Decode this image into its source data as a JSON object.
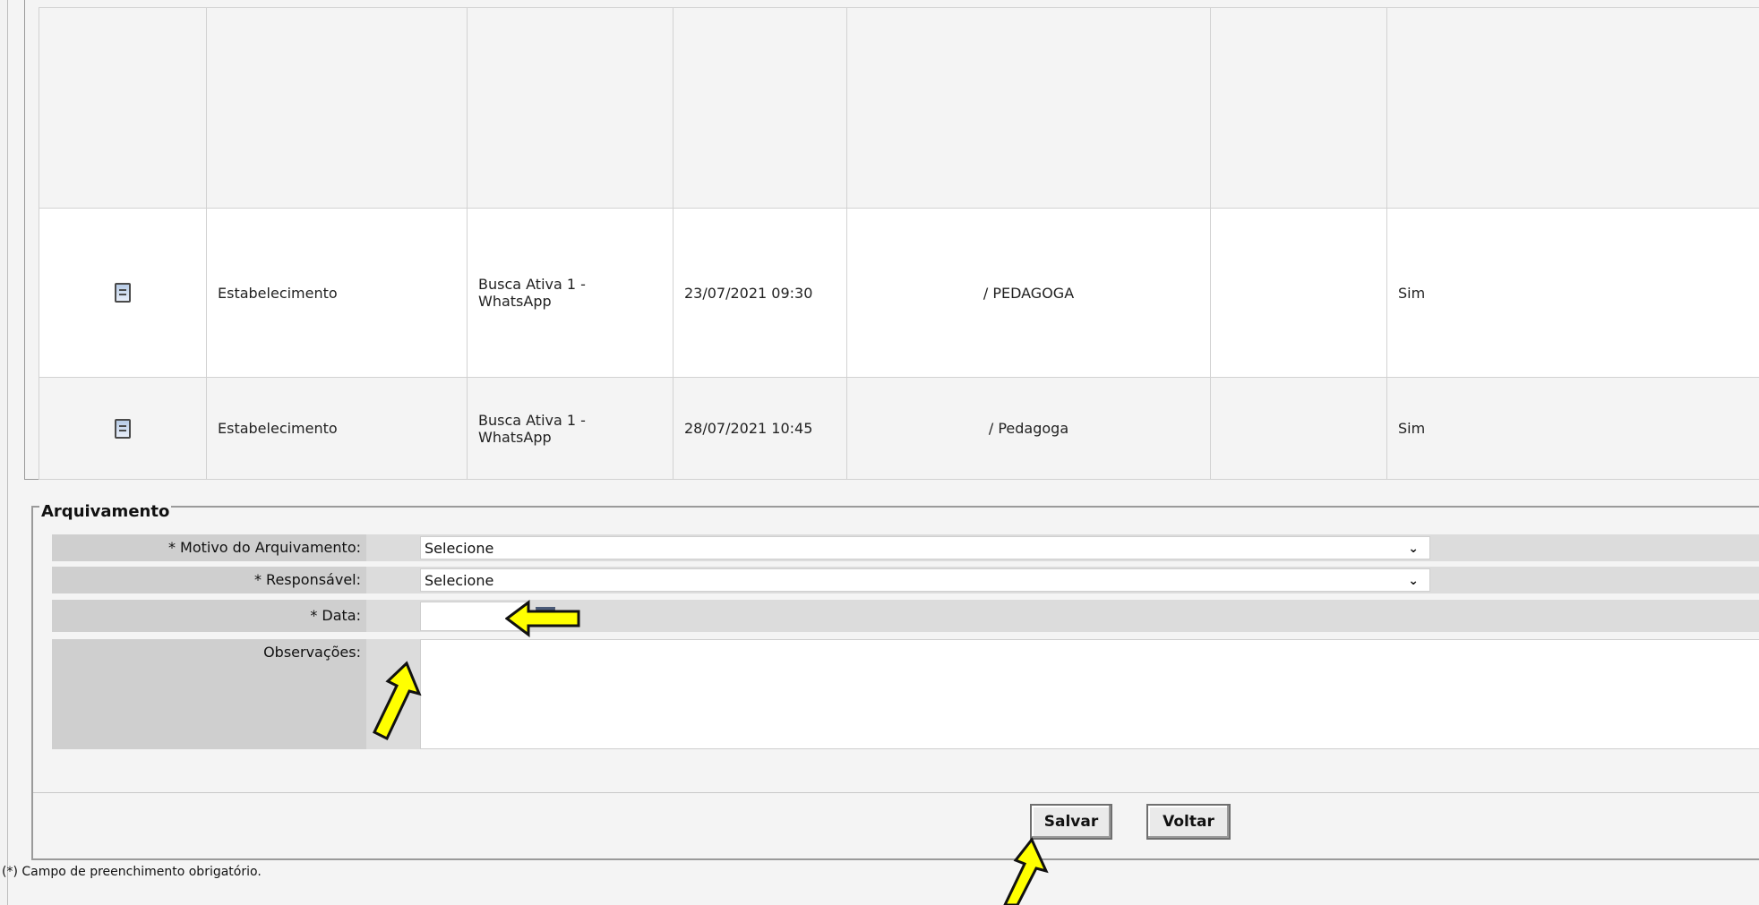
{
  "table": {
    "rows": [
      {
        "col1": "Estabelecimento",
        "col2": "Busca Ativa 1 - WhatsApp",
        "datetime": "23/07/2021 09:30",
        "role": "/ PEDAGOGA",
        "col5": "",
        "flag": "Sim"
      },
      {
        "col1": "Estabelecimento",
        "col2": "Busca Ativa 1 - WhatsApp",
        "datetime": "28/07/2021 10:45",
        "role": "/ Pedagoga",
        "col5": "",
        "flag": "Sim"
      }
    ]
  },
  "form": {
    "legend": "Arquivamento",
    "motivo_label": "* Motivo do Arquivamento:",
    "motivo_value": "Selecione",
    "responsavel_label": "* Responsável:",
    "responsavel_value": "Selecione",
    "data_label": "* Data:",
    "data_value": "",
    "obs_label": "Observações:",
    "obs_value": ""
  },
  "buttons": {
    "save": "Salvar",
    "back": "Voltar"
  },
  "footnote": "(*) Campo de preenchimento obrigatório.",
  "icons": {
    "row_icon": "document-icon",
    "calendar": "calendar-icon",
    "annotation": "arrow-annotation-icon"
  },
  "colors": {
    "annotation_arrow": "#ffff00"
  }
}
